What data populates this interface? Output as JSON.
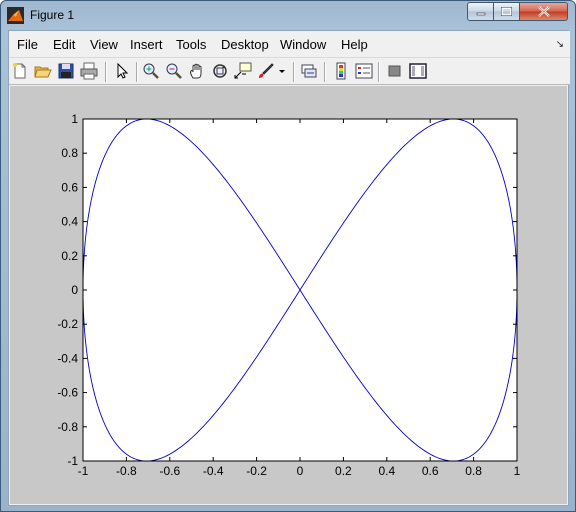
{
  "window": {
    "title": "Figure 1"
  },
  "menu": {
    "items": [
      "File",
      "Edit",
      "View",
      "Insert",
      "Tools",
      "Desktop",
      "Window",
      "Help"
    ]
  },
  "toolbar": {
    "icons": [
      "new-figure-icon",
      "open-file-icon",
      "save-icon",
      "print-icon",
      "arrow-select-icon",
      "zoom-in-icon",
      "zoom-out-icon",
      "pan-hand-icon",
      "rotate-3d-icon",
      "data-cursor-icon",
      "brush-icon",
      "brush-dropdown-icon",
      "link-plot-icon",
      "colorbar-icon",
      "legend-icon",
      "hide-plot-tools-icon",
      "show-plot-tools-icon"
    ]
  },
  "colors": {
    "line": "#0000cc",
    "figure_bg": "#c8c8c8",
    "axes_bg": "#ffffff"
  },
  "chart_data": {
    "type": "line",
    "title": "",
    "xlabel": "",
    "ylabel": "",
    "xlim": [
      -1,
      1
    ],
    "ylim": [
      -1,
      1
    ],
    "grid": false,
    "xticks": [
      -1,
      -0.8,
      -0.6,
      -0.4,
      -0.2,
      0,
      0.2,
      0.4,
      0.6,
      0.8,
      1
    ],
    "yticks": [
      -1,
      -0.8,
      -0.6,
      -0.4,
      -0.2,
      0,
      0.2,
      0.4,
      0.6,
      0.8,
      1
    ],
    "xtick_labels": [
      "-1",
      "-0.8",
      "-0.6",
      "-0.4",
      "-0.2",
      "0",
      "0.2",
      "0.4",
      "0.6",
      "0.8",
      "1"
    ],
    "ytick_labels": [
      "-1",
      "-0.8",
      "-0.6",
      "-0.4",
      "-0.2",
      "0",
      "0.2",
      "0.4",
      "0.6",
      "0.8",
      "1"
    ],
    "series": [
      {
        "x_expr": "sin(t)",
        "y_expr": "sin(2t)",
        "note_curve": "lissajous",
        "x": [
          0,
          0.707,
          1,
          0.707,
          0,
          -0.707,
          -1,
          -0.707,
          0
        ],
        "y": [
          0,
          1,
          0,
          -1,
          0,
          1,
          0,
          -1,
          0
        ]
      }
    ]
  }
}
